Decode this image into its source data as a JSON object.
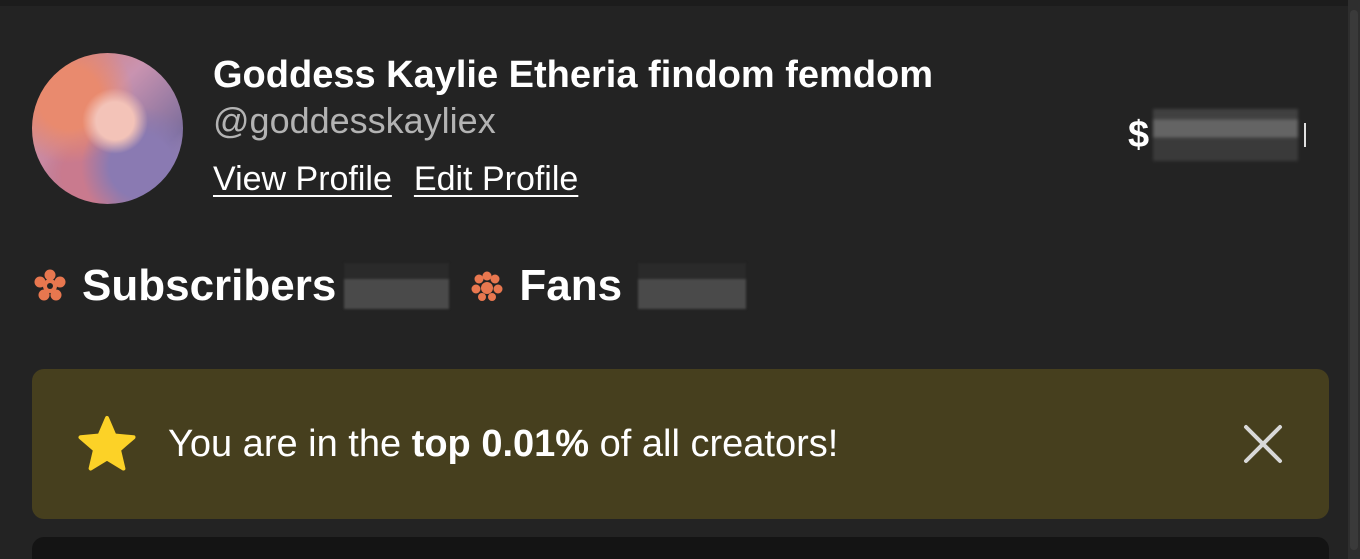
{
  "profile": {
    "display_name": "Goddess Kaylie Etheria findom femdom",
    "username": "@goddesskayliex",
    "view_profile_label": "View Profile",
    "edit_profile_label": "Edit Profile"
  },
  "balance": {
    "currency_symbol": "$"
  },
  "stats": {
    "subscribers_label": "Subscribers",
    "subscribers_icon": "subscribers-icon",
    "fans_label": "Fans",
    "fans_icon": "fans-icon"
  },
  "banner": {
    "icon": "star-icon",
    "text_before": "You are in the ",
    "text_bold": "top 0.01%",
    "text_after": " of all creators!",
    "close_icon": "close-icon"
  },
  "colors": {
    "background": "#232323",
    "banner_background": "#463f1e",
    "accent_orange": "#e8774f",
    "star_yellow": "#fcd227",
    "username_gray": "#b3b3b3"
  }
}
